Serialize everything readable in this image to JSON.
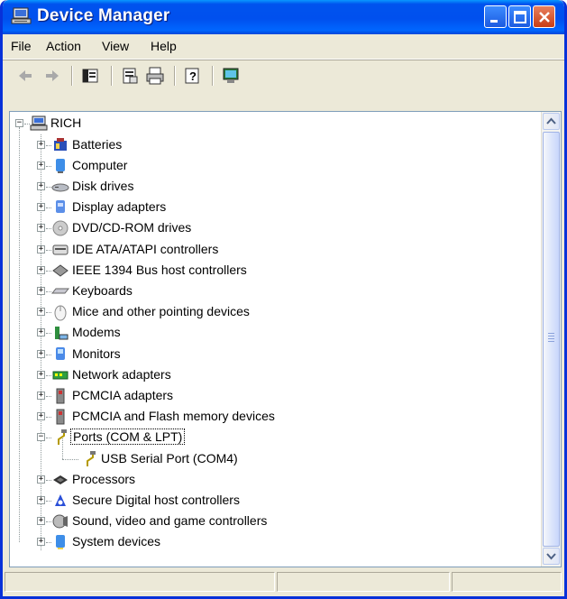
{
  "window": {
    "title": "Device Manager"
  },
  "menu": {
    "file": {
      "label": "File"
    },
    "action": {
      "label": "Action"
    },
    "view": {
      "label": "View"
    },
    "help": {
      "label": "Help"
    }
  },
  "toolbar": {
    "buttons": [
      "back-arrow",
      "forward-arrow",
      "show-hide-console-tree",
      "properties",
      "print",
      "help",
      "scan-hardware"
    ]
  },
  "tree": {
    "root": {
      "label": "RICH",
      "icon": "computer-icon"
    },
    "items": [
      {
        "label": "Batteries",
        "icon": "battery-icon",
        "expanded": false
      },
      {
        "label": "Computer",
        "icon": "computer-icon",
        "expanded": false
      },
      {
        "label": "Disk drives",
        "icon": "disk-drive-icon",
        "expanded": false
      },
      {
        "label": "Display adapters",
        "icon": "display-adapter-icon",
        "expanded": false
      },
      {
        "label": "DVD/CD-ROM drives",
        "icon": "dvd-drive-icon",
        "expanded": false
      },
      {
        "label": "IDE ATA/ATAPI controllers",
        "icon": "ide-controller-icon",
        "expanded": false
      },
      {
        "label": "IEEE 1394 Bus host controllers",
        "icon": "ieee1394-icon",
        "expanded": false
      },
      {
        "label": "Keyboards",
        "icon": "keyboard-icon",
        "expanded": false
      },
      {
        "label": "Mice and other pointing devices",
        "icon": "mouse-icon",
        "expanded": false
      },
      {
        "label": "Modems",
        "icon": "modem-icon",
        "expanded": false
      },
      {
        "label": "Monitors",
        "icon": "monitor-icon",
        "expanded": false
      },
      {
        "label": "Network adapters",
        "icon": "network-adapter-icon",
        "expanded": false
      },
      {
        "label": "PCMCIA adapters",
        "icon": "pcmcia-icon",
        "expanded": false
      },
      {
        "label": "PCMCIA and Flash memory devices",
        "icon": "pcmcia-icon",
        "expanded": false
      },
      {
        "label": "Ports (COM & LPT)",
        "icon": "port-icon",
        "expanded": true,
        "selected": true
      },
      {
        "label": "USB Serial Port (COM4)",
        "icon": "port-icon",
        "child": true
      },
      {
        "label": "Processors",
        "icon": "processor-icon",
        "expanded": false
      },
      {
        "label": "Secure Digital host controllers",
        "icon": "sd-controller-icon",
        "expanded": false
      },
      {
        "label": "Sound, video and game controllers",
        "icon": "sound-icon",
        "expanded": false
      },
      {
        "label": "System devices",
        "icon": "system-device-icon",
        "expanded": false
      }
    ]
  }
}
